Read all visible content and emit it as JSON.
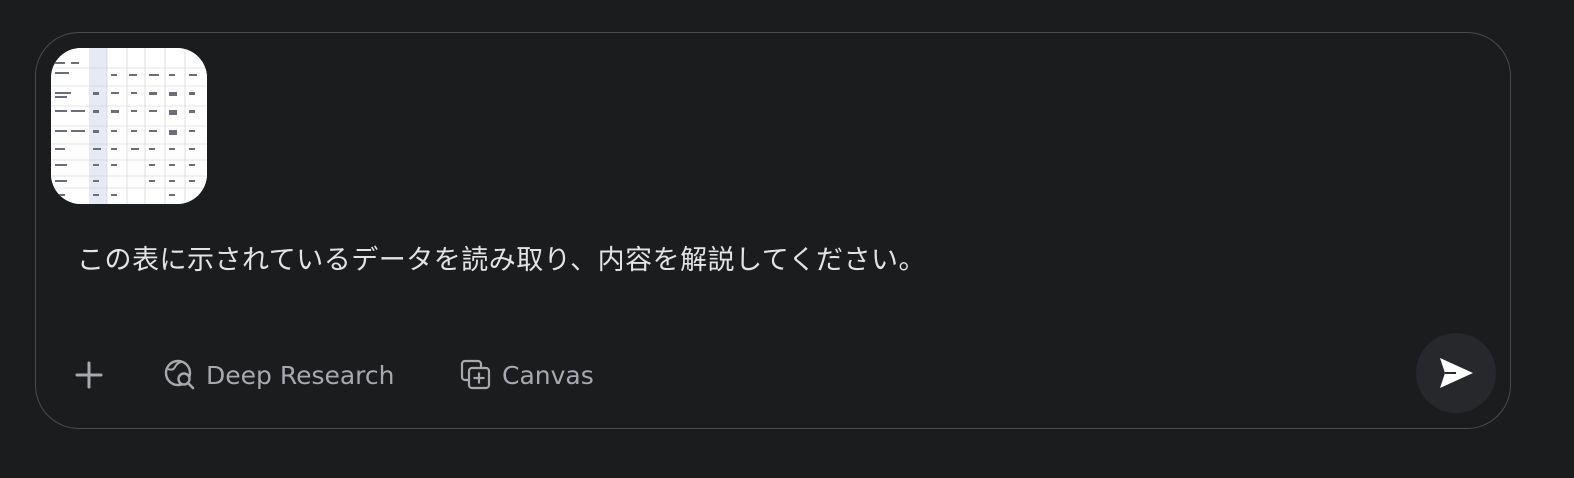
{
  "composer": {
    "attachment": {
      "icon": "table-image-thumbnail"
    },
    "prompt": "この表に示されているデータを読み取り、内容を解説してください。",
    "toolbar": {
      "add_icon": "plus-icon",
      "deep_research": {
        "label": "Deep Research",
        "icon": "globe-search-icon"
      },
      "canvas": {
        "label": "Canvas",
        "icon": "canvas-add-icon"
      }
    },
    "send": {
      "icon": "send-icon"
    }
  },
  "colors": {
    "background": "#1b1c1e",
    "border": "#4a4b4f",
    "text": "#e3e3e3",
    "muted": "#a8a9ad",
    "send_bg": "#27282b"
  }
}
